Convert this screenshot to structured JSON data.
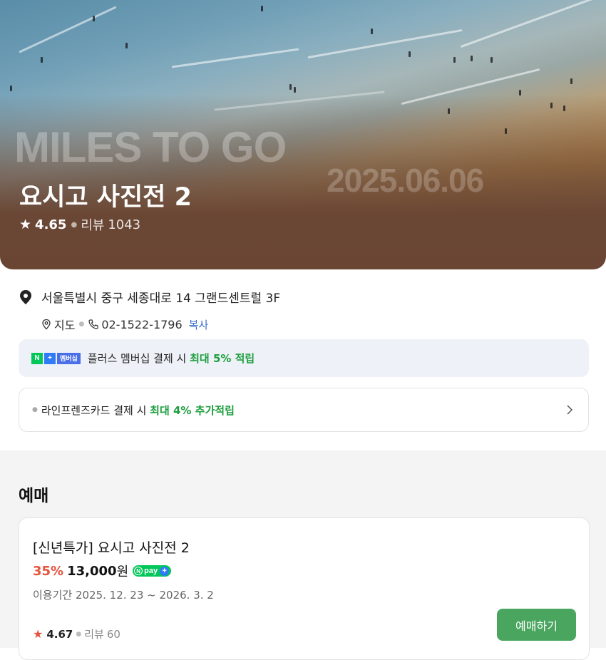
{
  "hero": {
    "overlay_text": "MILES TO GO",
    "overlay_date": "2025.06.06",
    "title": "요시고 사진전 2",
    "rating_star": "★",
    "rating": "4.65",
    "review_label": "리뷰",
    "review_count": "1043"
  },
  "info": {
    "address": "서울특별시 중구 세종대로 14 그랜드센트럴 3F",
    "map_label": "지도",
    "phone": "02-1522-1796",
    "copy_label": "복사"
  },
  "membership": {
    "badge_n": "N",
    "badge_plus": "+",
    "badge_membership": "멤버십",
    "text_prefix": "플러스 멤버십 결제 시 ",
    "text_highlight": "최대 5% 적립"
  },
  "card_banner": {
    "text_prefix": "라인프렌즈카드 결제 시 ",
    "text_highlight": "최대 4% 추가적립"
  },
  "booking": {
    "section_title": "예매",
    "ticket": {
      "name": "[신년특가] 요시고 사진전 2",
      "discount": "35%",
      "price": "13,000",
      "currency": "원",
      "npay_label": "pay",
      "period": "이용기간 2025. 12. 23 ~ 2026. 3. 2",
      "rating_star": "★",
      "rating": "4.67",
      "review_label": "리뷰",
      "review_count": "60",
      "button_label": "예매하기"
    }
  },
  "colors": {
    "accent_green": "#1e9e3e",
    "button_green": "#4aa55f",
    "discount_red": "#e5533d",
    "link_blue": "#3a6fd0",
    "membership_bg": "#eef2f8"
  }
}
